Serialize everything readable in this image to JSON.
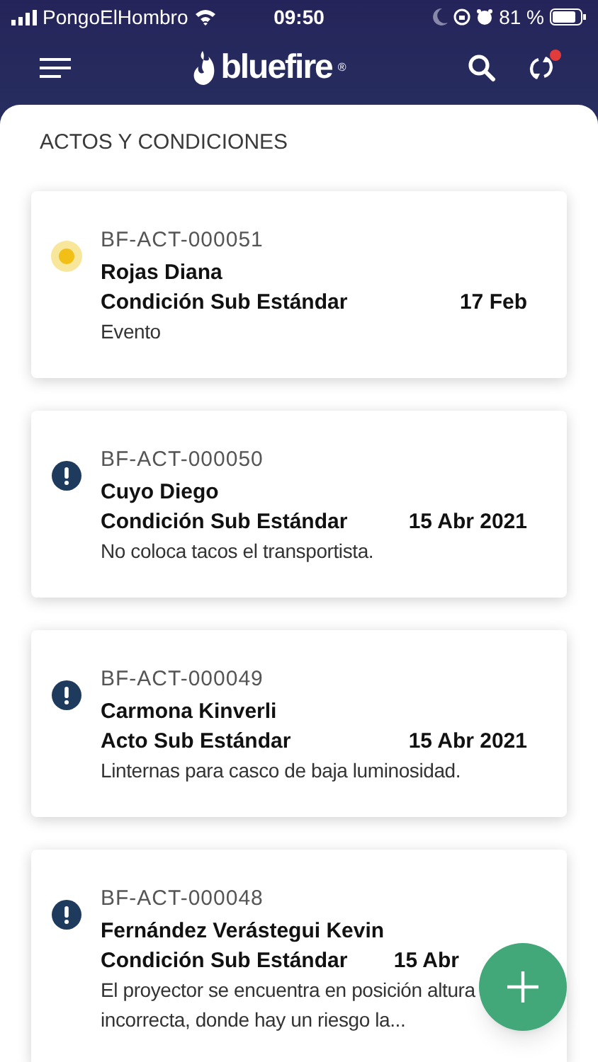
{
  "status_bar": {
    "carrier": "PongoElHombro",
    "time": "09:50",
    "battery": "81 %"
  },
  "app_bar": {
    "logo": "bluefire",
    "logo_mark": "®",
    "sync_pending": true
  },
  "section_title": "ACTOS Y CONDICIONES",
  "records": [
    {
      "kind": "pending",
      "code": "BF-ACT-000051",
      "person": "Rojas Diana",
      "type": "Condición Sub Estándar",
      "date": "17 Feb",
      "description": "Evento"
    },
    {
      "kind": "alert",
      "code": "BF-ACT-000050",
      "person": "Cuyo Diego",
      "type": "Condición Sub Estándar",
      "date": "15 Abr 2021",
      "description": "No coloca tacos el transportista."
    },
    {
      "kind": "alert",
      "code": "BF-ACT-000049",
      "person": "Carmona Kinverli",
      "type": "Acto Sub Estándar",
      "date": "15 Abr 2021",
      "description": "Linternas para casco de baja luminosidad."
    },
    {
      "kind": "alert",
      "code": "BF-ACT-000048",
      "person": "Fernández Verástegui Kevin",
      "type": "Condición Sub Estándar",
      "date": "15 Abr",
      "description": "El proyector se encuentra en posición altura incorrecta, donde hay un riesgo la..."
    }
  ]
}
